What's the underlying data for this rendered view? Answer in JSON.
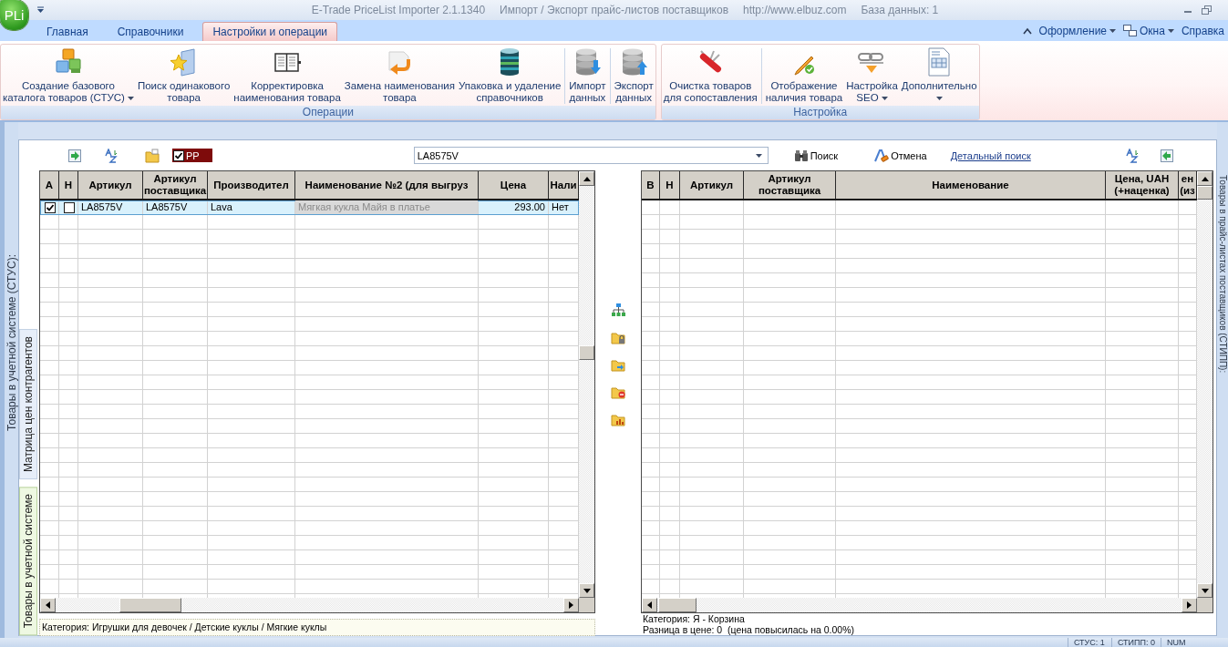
{
  "window": {
    "logo": "PLi",
    "title": "E-Trade PriceList Importer 2.1.1340",
    "subtitle": "Импорт / Экспорт прайс-листов поставщиков",
    "url": "http://www.elbuz.com",
    "database": "База данных: 1"
  },
  "tabs": [
    {
      "label": "Главная",
      "selected": false
    },
    {
      "label": "Справочники",
      "selected": false
    },
    {
      "label": "Настройки и операции",
      "selected": true
    }
  ],
  "menu": [
    {
      "label": "Оформление",
      "kind": "dropdown"
    },
    {
      "label": "Окна",
      "kind": "windows"
    },
    {
      "label": "Справка",
      "kind": "plain"
    }
  ],
  "ribbon_groups": [
    {
      "label": "Операции",
      "buttons": [
        {
          "label": "Создание базового\nкаталога товаров (СТУС)",
          "kind": "blocks",
          "dropdown": true,
          "separator_before": false
        },
        {
          "label": "Поиск одинакового\nтовара",
          "kind": "star-folder",
          "dropdown": false,
          "separator_before": false
        },
        {
          "label": "Корректировка\nнаименования товара",
          "kind": "notebook",
          "dropdown": false,
          "separator_before": false
        },
        {
          "label": "Замена наименования\nтовара",
          "kind": "replace",
          "dropdown": false,
          "separator_before": false
        },
        {
          "label": "Упаковка и удаление\nсправочников",
          "kind": "database",
          "dropdown": false,
          "separator_before": false
        },
        {
          "label": "Импорт\nданных",
          "kind": "import",
          "dropdown": false,
          "separator_before": true
        },
        {
          "label": "Экспорт\nданных",
          "kind": "export",
          "dropdown": false,
          "separator_before": true
        }
      ]
    },
    {
      "label": "Настройка",
      "buttons": [
        {
          "label": "Очистка товаров\nдля сопоставления",
          "kind": "knife",
          "dropdown": false,
          "separator_before": false
        },
        {
          "label": "Отображение\nналичия товара",
          "kind": "pencil",
          "dropdown": false,
          "separator_before": true
        },
        {
          "label": "Настройка\nSEO",
          "kind": "chain",
          "dropdown": true,
          "separator_before": false
        },
        {
          "label": "Дополнительно",
          "kind": "document",
          "dropdown": true,
          "separator_before": false
        }
      ]
    }
  ],
  "side_label": "Товары в учетной системе (СТУС):",
  "side_tabs": [
    {
      "label": "Матрица цен контрагентов",
      "selected": false
    },
    {
      "label": "Товары в учетной системе",
      "selected": true
    }
  ],
  "toolbar": {
    "filter": {
      "label": "PP",
      "checked": true
    },
    "search": {
      "value": "LA8575V"
    },
    "buttons": [
      {
        "label": "Поиск",
        "kind": "binoculars"
      },
      {
        "label": "Отмена",
        "kind": "cancel"
      }
    ],
    "link": "Детальный поиск"
  },
  "left_grid": {
    "columns": [
      {
        "label": "А",
        "kind": "check"
      },
      {
        "label": "Н",
        "kind": "check"
      },
      {
        "label": "Артикул",
        "kind": "text"
      },
      {
        "label": "Артикул\nпоставщика",
        "kind": "text"
      },
      {
        "label": "Производител",
        "kind": "text"
      },
      {
        "label": "Наименование №2 (для выгруз",
        "kind": "readonly"
      },
      {
        "label": "Цена",
        "kind": "number"
      },
      {
        "label": "Нали",
        "kind": "text"
      }
    ],
    "rows": [
      {
        "selected": true,
        "cells": [
          {
            "checked": true
          },
          {
            "checked": false
          },
          {
            "text": "LA8575V"
          },
          {
            "text": "LA8575V"
          },
          {
            "text": "Lava"
          },
          {
            "text": "Мягкая кукла Майя в платье"
          },
          {
            "text": "293.00"
          },
          {
            "text": "Нет"
          }
        ]
      }
    ],
    "category": "Категория: Игрушки для девочек / Детские куклы / Мягкие куклы"
  },
  "right_grid": {
    "columns": [
      {
        "label": "В"
      },
      {
        "label": "Н"
      },
      {
        "label": "Артикул"
      },
      {
        "label": "Артикул\nпоставщика"
      },
      {
        "label": "Наименование"
      },
      {
        "label": "Цена, UAH\n(+наценка)"
      },
      {
        "label": "ен\n(из"
      }
    ],
    "category": "Категория: Я - Корзина",
    "price_diff": "Разница в цене: 0  (цена повысилась на 0.00%)"
  },
  "right_side_label": "Товары в прайс-листах поставщиков (СТИПП):",
  "status_bar": [
    "СТУС: 1",
    "СТИПП: 0",
    "NUM"
  ]
}
